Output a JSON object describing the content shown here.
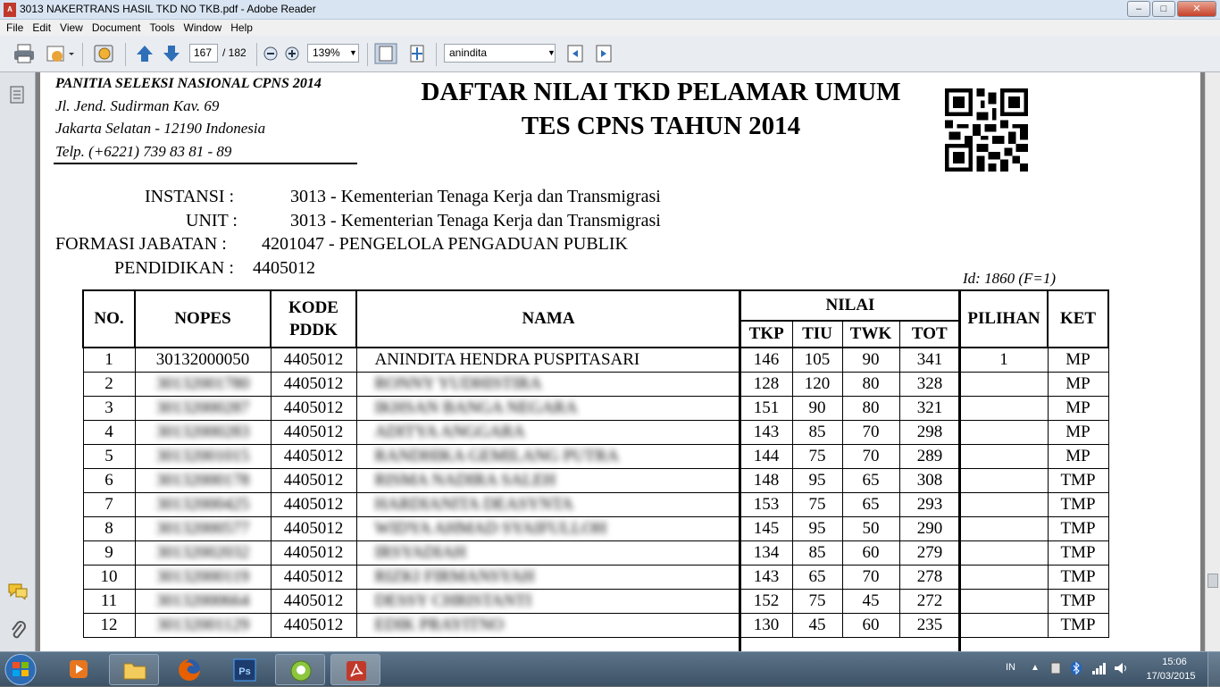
{
  "window": {
    "title": "3013 NAKERTRANS HASIL TKD NO TKB.pdf - Adobe Reader",
    "minimize": "–",
    "maximize": "□",
    "close": "✕"
  },
  "menu": [
    "File",
    "Edit",
    "View",
    "Document",
    "Tools",
    "Window",
    "Help"
  ],
  "toolbar": {
    "page_current": "167",
    "page_total": "/ 182",
    "zoom": "139%",
    "search_value": "anindita"
  },
  "header": {
    "org_name": "PANITIA SELEKSI NASIONAL CPNS 2014",
    "address1": "Jl. Jend. Sudirman Kav. 69",
    "address2": "Jakarta Selatan - 12190 Indonesia",
    "phone": "Telp. (+6221) 739 83 81 - 89",
    "title1": "DAFTAR NILAI TKD PELAMAR UMUM",
    "title2": "TES CPNS TAHUN 2014"
  },
  "info": {
    "instansi_label": "INSTANSI :",
    "instansi_value": "3013 - Kementerian Tenaga Kerja dan Transmigrasi",
    "unit_label": "UNIT :",
    "unit_value": "3013 - Kementerian Tenaga Kerja dan Transmigrasi",
    "formasi_label": "FORMASI JABATAN :",
    "formasi_value": "4201047 - PENGELOLA PENGADUAN PUBLIK",
    "pendidikan_label": "PENDIDIKAN :",
    "pendidikan_value": "4405012",
    "id_text": "Id: 1860 (F=1)"
  },
  "table": {
    "headers": {
      "no": "NO.",
      "nopes": "NOPES",
      "kode1": "KODE",
      "kode2": "PDDK",
      "nama": "NAMA",
      "nilai": "NILAI",
      "tkp": "TKP",
      "tiu": "TIU",
      "twk": "TWK",
      "tot": "TOT",
      "pilihan": "PILIHAN",
      "ket": "KET"
    },
    "rows": [
      {
        "no": "1",
        "nopes": "30132000050",
        "kode": "4405012",
        "nama": "ANINDITA HENDRA PUSPITASARI",
        "tkp": "146",
        "tiu": "105",
        "twk": "90",
        "tot": "341",
        "pilihan": "1",
        "ket": "MP"
      },
      {
        "no": "2",
        "nopes": "30132001780",
        "kode": "4405012",
        "nama": "RONNY YUDHISTIRA",
        "tkp": "128",
        "tiu": "120",
        "twk": "80",
        "tot": "328",
        "pilihan": "",
        "ket": "MP"
      },
      {
        "no": "3",
        "nopes": "30132000287",
        "kode": "4405012",
        "nama": "IKHSAN BANGA NEGARA",
        "tkp": "151",
        "tiu": "90",
        "twk": "80",
        "tot": "321",
        "pilihan": "",
        "ket": "MP"
      },
      {
        "no": "4",
        "nopes": "30132000283",
        "kode": "4405012",
        "nama": "ADITYA ANGGARA",
        "tkp": "143",
        "tiu": "85",
        "twk": "70",
        "tot": "298",
        "pilihan": "",
        "ket": "MP"
      },
      {
        "no": "5",
        "nopes": "30132001015",
        "kode": "4405012",
        "nama": "RANDHIKA GEMILANG PUTRA",
        "tkp": "144",
        "tiu": "75",
        "twk": "70",
        "tot": "289",
        "pilihan": "",
        "ket": "MP"
      },
      {
        "no": "6",
        "nopes": "30132000178",
        "kode": "4405012",
        "nama": "RISMA NADIRA SALEH",
        "tkp": "148",
        "tiu": "95",
        "twk": "65",
        "tot": "308",
        "pilihan": "",
        "ket": "TMP"
      },
      {
        "no": "7",
        "nopes": "30132000425",
        "kode": "4405012",
        "nama": "HARDIANITA DEASYNTA",
        "tkp": "153",
        "tiu": "75",
        "twk": "65",
        "tot": "293",
        "pilihan": "",
        "ket": "TMP"
      },
      {
        "no": "8",
        "nopes": "30132000577",
        "kode": "4405012",
        "nama": "WIDYA AHMAD SYAIFULLOH",
        "tkp": "145",
        "tiu": "95",
        "twk": "50",
        "tot": "290",
        "pilihan": "",
        "ket": "TMP"
      },
      {
        "no": "9",
        "nopes": "30132002032",
        "kode": "4405012",
        "nama": "IRSYADIAH",
        "tkp": "134",
        "tiu": "85",
        "twk": "60",
        "tot": "279",
        "pilihan": "",
        "ket": "TMP"
      },
      {
        "no": "10",
        "nopes": "30132000119",
        "kode": "4405012",
        "nama": "RIZKI FIRMANSYAH",
        "tkp": "143",
        "tiu": "65",
        "twk": "70",
        "tot": "278",
        "pilihan": "",
        "ket": "TMP"
      },
      {
        "no": "11",
        "nopes": "30132000664",
        "kode": "4405012",
        "nama": "DESSY CHRISTANTI",
        "tkp": "152",
        "tiu": "75",
        "twk": "45",
        "tot": "272",
        "pilihan": "",
        "ket": "TMP"
      },
      {
        "no": "12",
        "nopes": "30132001129",
        "kode": "4405012",
        "nama": "EDIK PRAYITNO",
        "tkp": "130",
        "tiu": "45",
        "twk": "60",
        "tot": "235",
        "pilihan": "",
        "ket": "TMP"
      }
    ]
  },
  "taskbar": {
    "lang": "IN",
    "time": "15:06",
    "date": "17/03/2015"
  },
  "colors": {
    "accent": "#3d5266",
    "pdf_red": "#c0392b"
  }
}
